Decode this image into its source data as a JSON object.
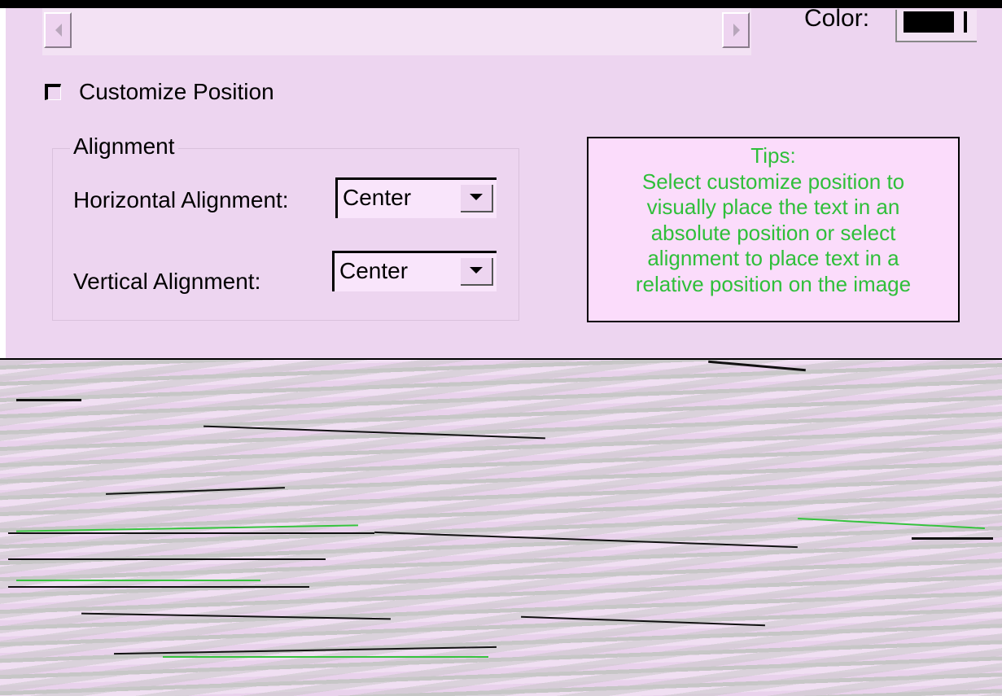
{
  "color_picker": {
    "label": "Color:",
    "value": "#000000"
  },
  "customize_position": {
    "label": "Customize Position",
    "checked": false
  },
  "alignment_group": {
    "title": "Alignment",
    "horizontal": {
      "label": "Horizontal Alignment:",
      "value": "Center"
    },
    "vertical": {
      "label": "Vertical Alignment:",
      "value": "Center"
    }
  },
  "tips": {
    "title": "Tips:",
    "lines": [
      "Select customize position to",
      "visually place the text in an",
      "absolute position or select",
      "alignment to place text in a",
      "relative position on the image"
    ]
  },
  "icons": {
    "scroll_left": "triangle-left-icon",
    "scroll_right": "triangle-right-icon",
    "dropdown": "triangle-down-icon"
  },
  "colors": {
    "dialog_bg": "#edd5f0",
    "tips_text": "#2fbf3a",
    "tips_bg": "#fbdcfb"
  }
}
